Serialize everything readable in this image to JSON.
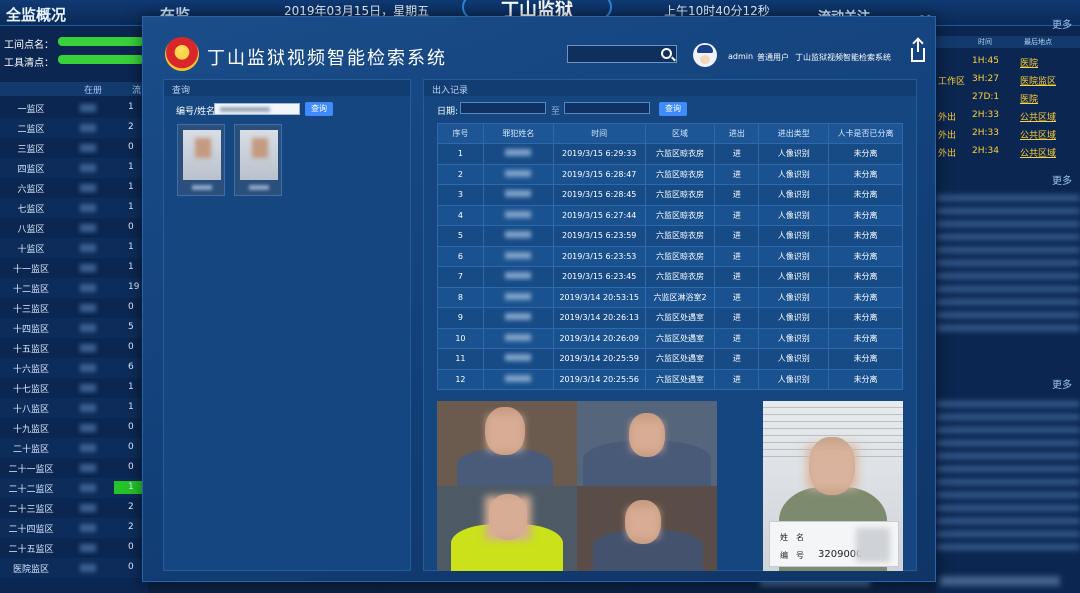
{
  "background": {
    "left_title": "全监概况",
    "zaijian": "在监",
    "date": "2019年03月15日，星期五",
    "center_title": "丁山监狱",
    "time": "上午10时40分12秒",
    "activity_title": "流动关注",
    "stat_rows": [
      "工间点名：",
      "工具清点："
    ],
    "left_columns": [
      "在册",
      "流"
    ],
    "districts": [
      {
        "name": "一监区",
        "value": "1"
      },
      {
        "name": "二监区",
        "value": "2"
      },
      {
        "name": "三监区",
        "value": "0"
      },
      {
        "name": "四监区",
        "value": "1"
      },
      {
        "name": "六监区",
        "value": "1"
      },
      {
        "name": "七监区",
        "value": "1"
      },
      {
        "name": "八监区",
        "value": "0"
      },
      {
        "name": "十监区",
        "value": "1"
      },
      {
        "name": "十一监区",
        "value": "1"
      },
      {
        "name": "十二监区",
        "value": "19"
      },
      {
        "name": "十三监区",
        "value": "0"
      },
      {
        "name": "十四监区",
        "value": "5"
      },
      {
        "name": "十五监区",
        "value": "0"
      },
      {
        "name": "十六监区",
        "value": "6"
      },
      {
        "name": "十七监区",
        "value": "1"
      },
      {
        "name": "十八监区",
        "value": "1"
      },
      {
        "name": "十九监区",
        "value": "0"
      },
      {
        "name": "二十监区",
        "value": "0"
      },
      {
        "name": "二十一监区",
        "value": "0"
      },
      {
        "name": "二十二监区",
        "value": "1"
      },
      {
        "name": "二十三监区",
        "value": "2"
      },
      {
        "name": "二十四监区",
        "value": "2"
      },
      {
        "name": "二十五监区",
        "value": "0"
      },
      {
        "name": "医院监区",
        "value": "0"
      }
    ],
    "right_more_labels": [
      "更多",
      "更多",
      "更多"
    ],
    "right_columns": [
      "",
      "时间",
      "最后地点"
    ],
    "right_rows": [
      {
        "a": "",
        "b": "1H:45",
        "c": "医院"
      },
      {
        "a": "工作区",
        "b": "3H:27",
        "c": "医院监区"
      },
      {
        "a": "",
        "b": "27D:1",
        "c": "医院"
      },
      {
        "a": "外出",
        "b": "2H:33",
        "c": "公共区域"
      },
      {
        "a": "外出",
        "b": "2H:33",
        "c": "公共区域"
      },
      {
        "a": "外出",
        "b": "2H:34",
        "c": "公共区域"
      }
    ]
  },
  "modal": {
    "close_label": "X",
    "system_title": "丁山监狱视频智能检索系统",
    "user": {
      "name": "admin",
      "role": "普通用户",
      "system": "丁山监狱视频智能检索系统"
    },
    "query_panel": {
      "title": "查询",
      "field_label": "编号/姓名",
      "search_button": "查询"
    },
    "records_panel": {
      "title": "出入记录",
      "date_label": "日期:",
      "to_label": "至",
      "search_button": "查询",
      "columns": [
        "序号",
        "罪犯姓名",
        "时间",
        "区域",
        "进出",
        "进出类型",
        "人卡是否已分离"
      ],
      "rows": [
        {
          "no": "1",
          "time": "2019/3/15 6:29:33",
          "area": "六监区晾衣房",
          "io": "进",
          "type": "人像识别",
          "sep": "未分离"
        },
        {
          "no": "2",
          "time": "2019/3/15 6:28:47",
          "area": "六监区晾衣房",
          "io": "进",
          "type": "人像识别",
          "sep": "未分离"
        },
        {
          "no": "3",
          "time": "2019/3/15 6:28:45",
          "area": "六监区晾衣房",
          "io": "进",
          "type": "人像识别",
          "sep": "未分离"
        },
        {
          "no": "4",
          "time": "2019/3/15 6:27:44",
          "area": "六监区晾衣房",
          "io": "进",
          "type": "人像识别",
          "sep": "未分离"
        },
        {
          "no": "5",
          "time": "2019/3/15 6:23:59",
          "area": "六监区晾衣房",
          "io": "进",
          "type": "人像识别",
          "sep": "未分离"
        },
        {
          "no": "6",
          "time": "2019/3/15 6:23:53",
          "area": "六监区晾衣房",
          "io": "进",
          "type": "人像识别",
          "sep": "未分离"
        },
        {
          "no": "7",
          "time": "2019/3/15 6:23:45",
          "area": "六监区晾衣房",
          "io": "进",
          "type": "人像识别",
          "sep": "未分离"
        },
        {
          "no": "8",
          "time": "2019/3/14 20:53:15",
          "area": "六监区淋浴室2",
          "io": "进",
          "type": "人像识别",
          "sep": "未分离"
        },
        {
          "no": "9",
          "time": "2019/3/14 20:26:13",
          "area": "六监区处遇室",
          "io": "进",
          "type": "人像识别",
          "sep": "未分离"
        },
        {
          "no": "10",
          "time": "2019/3/14 20:26:09",
          "area": "六监区处遇室",
          "io": "进",
          "type": "人像识别",
          "sep": "未分离"
        },
        {
          "no": "11",
          "time": "2019/3/14 20:25:59",
          "area": "六监区处遇室",
          "io": "进",
          "type": "人像识别",
          "sep": "未分离"
        },
        {
          "no": "12",
          "time": "2019/3/14 20:25:56",
          "area": "六监区处遇室",
          "io": "进",
          "type": "人像识别",
          "sep": "未分离"
        }
      ]
    },
    "mugshot_card": {
      "name_label": "姓　名",
      "number_label": "编　号",
      "number_value": "3209000"
    }
  }
}
